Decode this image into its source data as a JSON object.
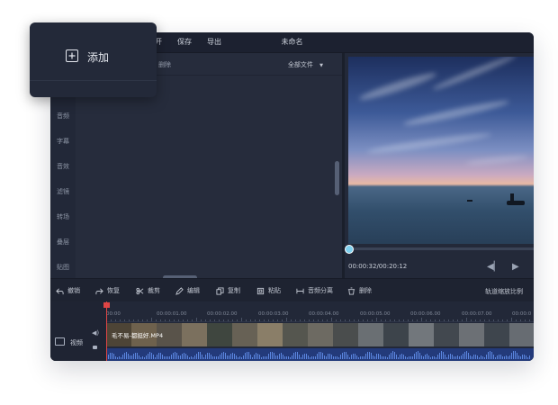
{
  "window": {
    "title": "未命名",
    "menu": [
      "开",
      "保存",
      "导出"
    ]
  },
  "popover": {
    "add_label": "添加"
  },
  "library": {
    "delete_label": "删除",
    "filter_label": "全部文件",
    "filter_arrow": "▼"
  },
  "sidebar": {
    "items": [
      {
        "label": "音频"
      },
      {
        "label": "字幕"
      },
      {
        "label": "音效"
      },
      {
        "label": "滤镜"
      },
      {
        "label": "转场"
      },
      {
        "label": "叠层"
      },
      {
        "label": "贴图"
      }
    ]
  },
  "preview": {
    "time": "00:00:32/00:20:12",
    "progress": 0.0
  },
  "toolbar": {
    "undo": "撤销",
    "redo": "恢复",
    "cut": "裁剪",
    "edit": "编辑",
    "copy": "复制",
    "paste": "粘贴",
    "audio_split": "音频分离",
    "delete": "删除",
    "fit_track": "轨道缩放比例"
  },
  "timeline": {
    "ruler": [
      "00:00",
      "00:00:01.00",
      "00:00:02.00",
      "00:00:03.00",
      "00:00:04.00",
      "00:00:05.00",
      "00:00:06.00",
      "00:00:07.00",
      "00:00:0"
    ],
    "track_label": "视频",
    "clip_name": "毛不易-都挺好.MP4"
  },
  "colors": {
    "accent": "#7fd0ee",
    "playhead": "#e04545",
    "audio": "#233a7a"
  }
}
